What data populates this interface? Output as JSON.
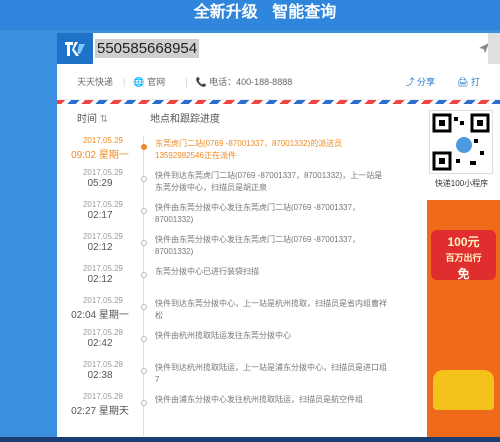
{
  "header": {
    "title1": "全新升级",
    "title2": "智能查询"
  },
  "search": {
    "value": "550585668954"
  },
  "info": {
    "carrier": "天天快递",
    "website": "官网",
    "phone": "电话：400-188-8888",
    "share": "分享",
    "print": "打"
  },
  "columns": {
    "time": "时间",
    "place": "地点和跟踪进度"
  },
  "events": [
    {
      "date": "2017.05.29",
      "time": "09:02 星期一",
      "text": "东莞虎门二站(0769 -87001337，87001332)的派送员13592982546正在派件",
      "latest": true
    },
    {
      "date": "2017.05.29",
      "time": "05:29",
      "text": "快件到达东莞虎门二站(0769 -87001337，87001332)，上一站是东莞分拨中心，扫描员是胡正泉"
    },
    {
      "date": "2017.05.29",
      "time": "02:17",
      "text": "快件由东莞分拨中心发往东莞虎门二站(0769 -87001337，87001332)"
    },
    {
      "date": "2017.05.29",
      "time": "02:12",
      "text": "快件由东莞分拨中心发往东莞虎门二站(0769 -87001337，87001332)"
    },
    {
      "date": "2017.05.29",
      "time": "02:12",
      "text": "东莞分拨中心已进行装袋扫描"
    },
    {
      "date": "2017.05.29",
      "time": "02:04 星期一",
      "text": "快件到达东莞分拨中心，上一站是杭州揽取，扫描员是省内组曹祥松"
    },
    {
      "date": "2017.05.28",
      "time": "02:42",
      "text": "快件由杭州揽取陆运发往东莞分拨中心"
    },
    {
      "date": "2017.05.28",
      "time": "02:38",
      "text": "快件到达杭州揽取陆运，上一站是浦东分拨中心，扫描员是进口组7"
    },
    {
      "date": "2017.05.28",
      "time": "02:27 星期天",
      "text": "快件由浦东分拨中心发往杭州揽取陆运，扫描员是航空件组"
    }
  ],
  "side": {
    "qr_caption": "快递100小程序",
    "ad_text1": "100元",
    "ad_text2": "百万出行",
    "ad_text3": "免"
  }
}
